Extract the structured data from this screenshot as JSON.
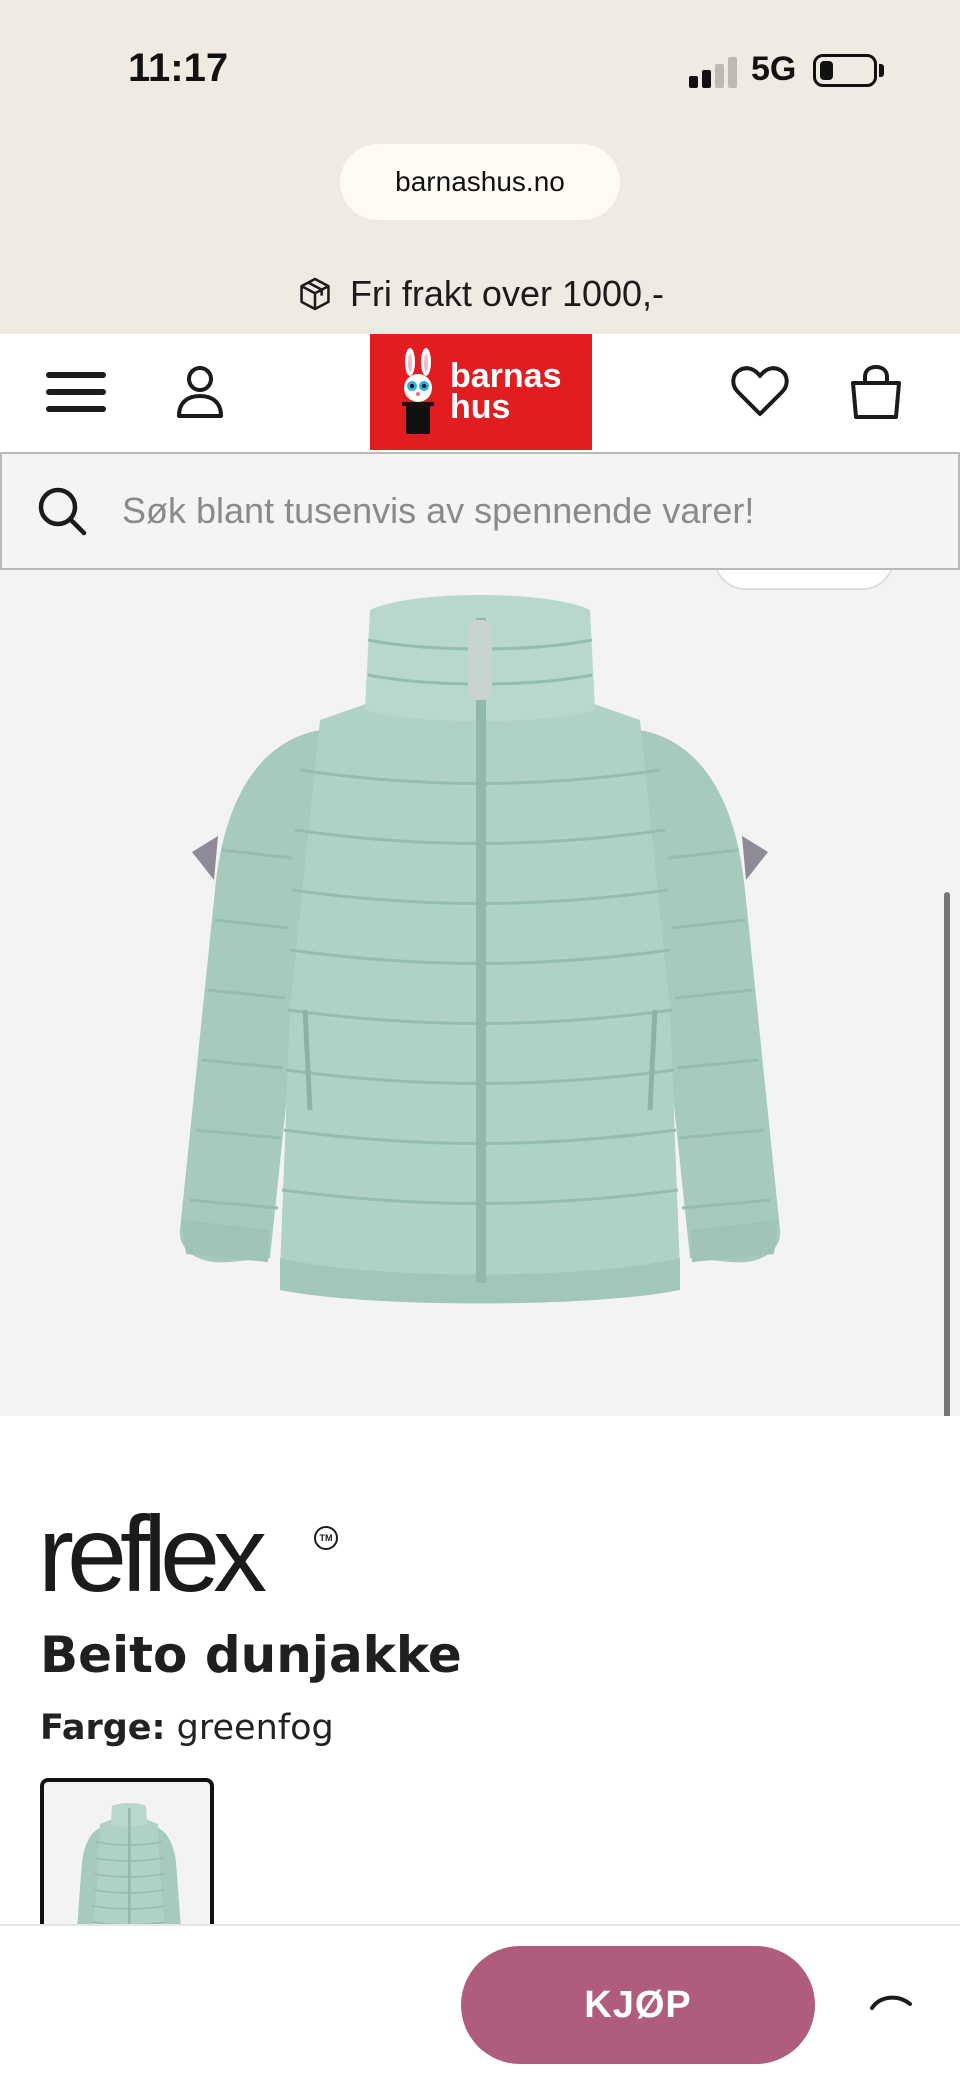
{
  "status_bar": {
    "time": "11:17",
    "network": "5G"
  },
  "browser": {
    "url": "barnashus.no"
  },
  "promo": {
    "text": "Fri frakt over 1000,-",
    "icon": "package-icon"
  },
  "header": {
    "logo_line1": "barnas",
    "logo_line2": "hus",
    "brand_color": "#e11d22",
    "icons": [
      "menu-icon",
      "account-icon",
      "heart-icon",
      "shopping-bag-icon"
    ]
  },
  "search": {
    "placeholder": "Søk blant tusenvis av spennende varer!"
  },
  "product": {
    "brand": "reflex",
    "trademark": "TM",
    "title": "Beito dunjakke",
    "color_label": "Farge:",
    "color_value": "greenfog",
    "jacket_color": "#a9cdbf"
  },
  "bottom_bar": {
    "buy_label": "KJØP",
    "buy_color": "#b05c7c"
  }
}
